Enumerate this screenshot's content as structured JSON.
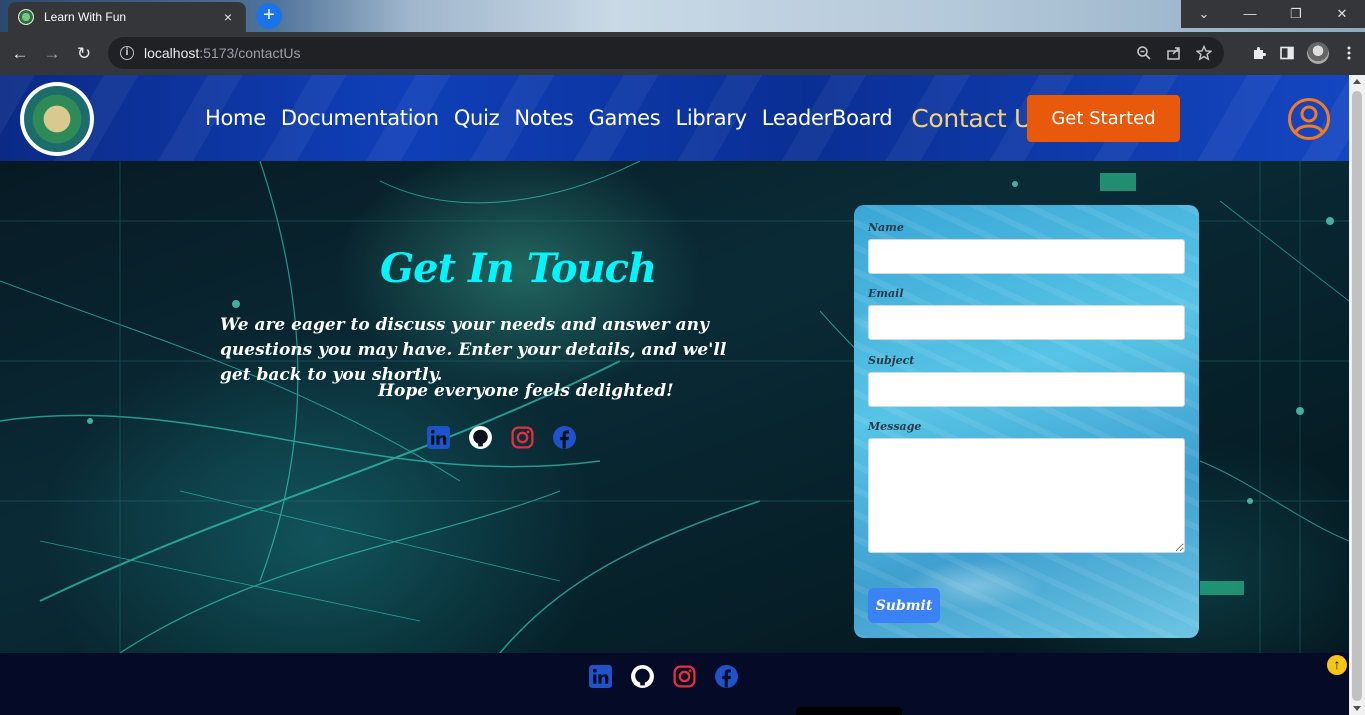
{
  "browser": {
    "tab_title": "Learn With Fun",
    "tab_close": "×",
    "new_tab": "+",
    "window_controls": [
      "⌄",
      "—",
      "❐",
      "✕"
    ],
    "url_host": "localhost",
    "url_path": ":5173/contactUs",
    "nav": {
      "back": "←",
      "forward": "→",
      "reload": "↻"
    },
    "omnibox_icons": [
      "zoom-icon",
      "share-icon",
      "bookmark-star-icon"
    ],
    "toolbar_icons": [
      "extensions-icon",
      "side-panel-icon",
      "profile-avatar",
      "menu-icon"
    ]
  },
  "header": {
    "logo_alt": "Learn With Fun - Grow With Me",
    "nav_items": [
      "Home",
      "Documentation",
      "Quiz",
      "Notes",
      "Games",
      "Library",
      "LeaderBoard",
      "Contact Us"
    ],
    "active_item": "Contact Us",
    "cta_label": "Get Started",
    "colors": {
      "active": "#f3d27a",
      "cta": "#e8590c",
      "user_icon": "#f47b20"
    }
  },
  "contact": {
    "title": "Get In Touch",
    "description": "We are eager to discuss your needs and answer any questions you may have. Enter your details, and we'll get back to you shortly.",
    "tagline": "Hope everyone feels delighted!",
    "socials": [
      "linkedin-icon",
      "github-icon",
      "instagram-icon",
      "facebook-icon"
    ]
  },
  "form": {
    "name_label": "Name",
    "name_value": "",
    "email_label": "Email",
    "email_value": "",
    "subject_label": "Subject",
    "subject_value": "",
    "message_label": "Message",
    "message_value": "",
    "submit_label": "Submit"
  },
  "footer": {
    "socials": [
      "linkedin-icon",
      "github-icon",
      "instagram-icon",
      "facebook-icon"
    ],
    "scroll_top": "↑"
  }
}
